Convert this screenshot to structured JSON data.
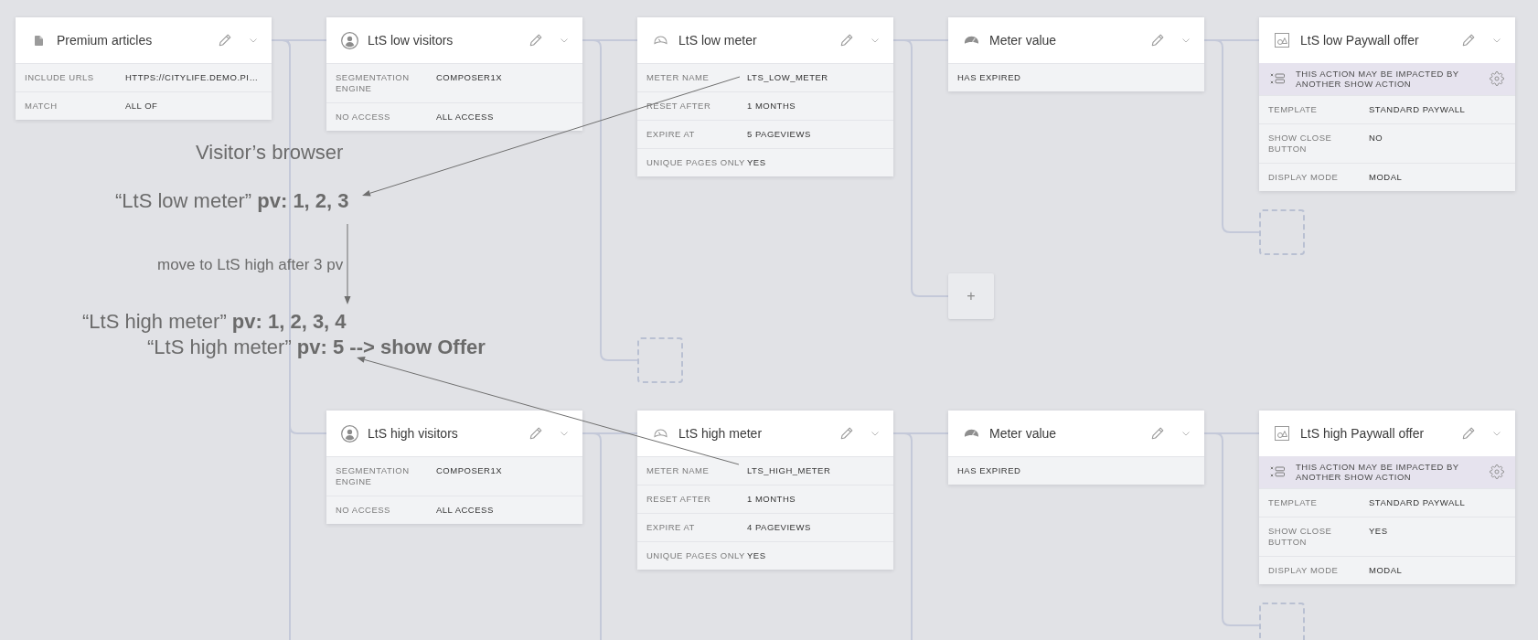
{
  "canvas": {
    "flow": {
      "kind": "content",
      "title": "Premium articles",
      "rows": [
        {
          "label": "INCLUDE URLS",
          "value": "HTTPS://CITYLIFE.DEMO.PI…"
        },
        {
          "label": "MATCH",
          "value": "ALL OF"
        }
      ],
      "continues_below": true,
      "children": [
        {
          "kind": "segment",
          "title": "LtS low visitors",
          "rows": [
            {
              "label": "SEGMENTATION ENGINE",
              "value": "COMPOSER1X"
            },
            {
              "label": "NO ACCESS",
              "value": "ALL ACCESS"
            }
          ],
          "continues_below": false,
          "children": [
            {
              "kind": "meter",
              "title": "LtS low meter",
              "rows": [
                {
                  "label": "METER NAME",
                  "value": "LTS_LOW_METER"
                },
                {
                  "label": "RESET AFTER",
                  "value": "1 MONTHS"
                },
                {
                  "label": "EXPIRE AT",
                  "value": "5 PAGEVIEWS"
                },
                {
                  "label": "UNIQUE PAGES ONLY",
                  "value": "YES"
                }
              ],
              "continues_below": false,
              "children": [
                {
                  "kind": "meter_value",
                  "title": "Meter value",
                  "rows": [
                    {
                      "value": "HAS EXPIRED"
                    }
                  ],
                  "continues_below": false,
                  "children": [
                    {
                      "kind": "offer",
                      "title": "LtS low Paywall offer",
                      "warning": "THIS ACTION MAY BE IMPACTED BY ANOTHER SHOW ACTION",
                      "rows": [
                        {
                          "label": "TEMPLATE",
                          "value": "STANDARD PAYWALL"
                        },
                        {
                          "label": "SHOW CLOSE BUTTON",
                          "value": "NO"
                        },
                        {
                          "label": "DISPLAY MODE",
                          "value": "MODAL"
                        }
                      ],
                      "continues_below": false
                    },
                    {
                      "kind": "placeholder"
                    }
                  ]
                },
                {
                  "kind": "add",
                  "label": "+"
                }
              ]
            },
            {
              "kind": "placeholder"
            }
          ]
        },
        {
          "kind": "segment",
          "title": "LtS high visitors",
          "rows": [
            {
              "label": "SEGMENTATION ENGINE",
              "value": "COMPOSER1X"
            },
            {
              "label": "NO ACCESS",
              "value": "ALL ACCESS"
            }
          ],
          "continues_below": true,
          "children": [
            {
              "kind": "meter",
              "title": "LtS high meter",
              "rows": [
                {
                  "label": "METER NAME",
                  "value": "LTS_HIGH_METER"
                },
                {
                  "label": "RESET AFTER",
                  "value": "1 MONTHS"
                },
                {
                  "label": "EXPIRE AT",
                  "value": "4 PAGEVIEWS"
                },
                {
                  "label": "UNIQUE PAGES ONLY",
                  "value": "YES"
                }
              ],
              "continues_below": true,
              "children": [
                {
                  "kind": "meter_value",
                  "title": "Meter value",
                  "rows": [
                    {
                      "value": "HAS EXPIRED"
                    }
                  ],
                  "continues_below": false,
                  "children": [
                    {
                      "kind": "offer",
                      "title": "LtS high Paywall offer",
                      "warning": "THIS ACTION MAY BE IMPACTED BY ANOTHER SHOW ACTION",
                      "rows": [
                        {
                          "label": "TEMPLATE",
                          "value": "STANDARD PAYWALL"
                        },
                        {
                          "label": "SHOW CLOSE BUTTON",
                          "value": "YES"
                        },
                        {
                          "label": "DISPLAY MODE",
                          "value": "MODAL"
                        }
                      ],
                      "continues_below": false
                    },
                    {
                      "kind": "placeholder"
                    }
                  ]
                }
              ]
            }
          ]
        }
      ]
    }
  },
  "annotations": [
    {
      "kind": "line",
      "text": "Visitor’s browser"
    },
    {
      "kind": "line",
      "text": "“LtS low meter” **pv: 1, 2, 3**"
    },
    {
      "kind": "note",
      "text": "move to LtS high after 3 pv"
    },
    {
      "kind": "line",
      "text": "“LtS high meter” **pv: 1, 2, 3, 4**"
    },
    {
      "kind": "line",
      "text": "“LtS high meter” **pv: 5 --> show Offer**"
    }
  ]
}
